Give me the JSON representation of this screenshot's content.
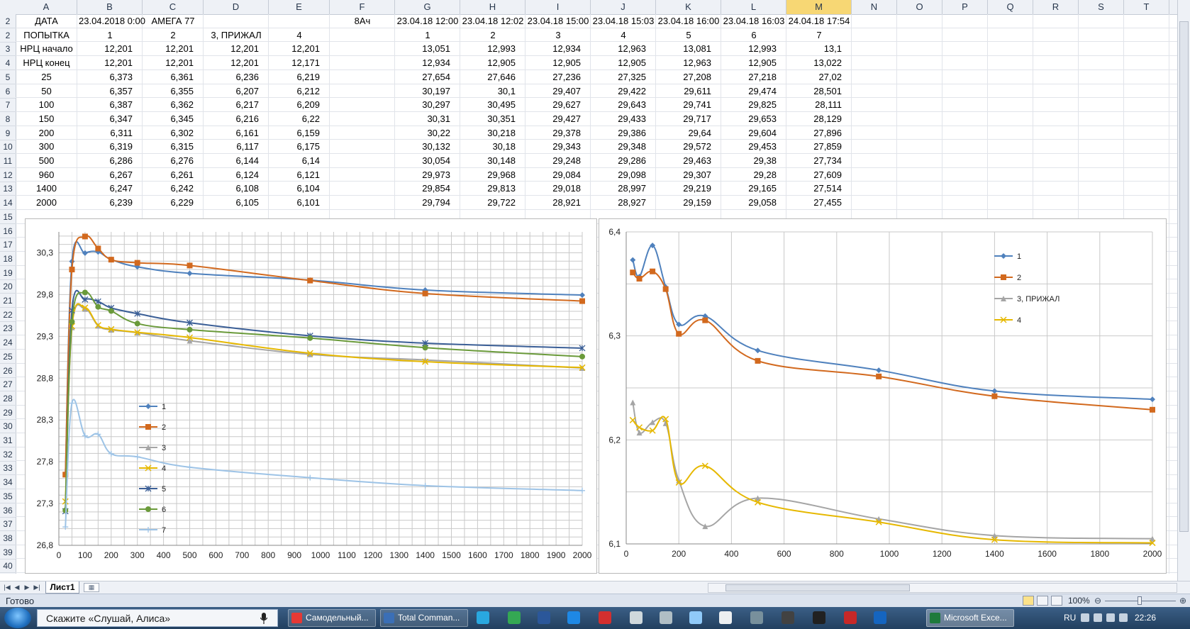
{
  "columns": [
    "A",
    "B",
    "C",
    "D",
    "E",
    "F",
    "G",
    "H",
    "I",
    "J",
    "K",
    "L",
    "M",
    "N",
    "O",
    "P",
    "Q",
    "R",
    "S",
    "T"
  ],
  "selected_column": "M",
  "rows_hdr": [
    "2",
    "2",
    "3",
    "4",
    "5",
    "6",
    "7",
    "8",
    "9",
    "10",
    "11",
    "12",
    "13",
    "14",
    "15",
    "16",
    "17",
    "18",
    "19",
    "20",
    "21",
    "22",
    "23",
    "24",
    "25",
    "26",
    "27",
    "28",
    "29",
    "30",
    "31",
    "32",
    "33",
    "34",
    "35",
    "36",
    "37",
    "38",
    "39",
    "40"
  ],
  "table": [
    [
      "ДАТА",
      "23.04.2018 0:00",
      "АМЕГА 77",
      "",
      "",
      "8Ач",
      "23.04.18 12:00",
      "23.04.18 12:02",
      "23.04.18 15:00",
      "23.04.18 15:03",
      "23.04.18 16:00",
      "23.04.18 16:03",
      "24.04.18 17:54"
    ],
    [
      "ПОПЫТКА",
      "1",
      "2",
      "3, ПРИЖАЛ",
      "4",
      "",
      "1",
      "2",
      "3",
      "4",
      "5",
      "6",
      "7"
    ],
    [
      "НРЦ начало",
      "12,201",
      "12,201",
      "12,201",
      "12,201",
      "",
      "13,051",
      "12,993",
      "12,934",
      "12,963",
      "13,081",
      "12,993",
      "13,1"
    ],
    [
      "НРЦ конец",
      "12,201",
      "12,201",
      "12,201",
      "12,171",
      "",
      "12,934",
      "12,905",
      "12,905",
      "12,905",
      "12,963",
      "12,905",
      "13,022"
    ],
    [
      "25",
      "6,373",
      "6,361",
      "6,236",
      "6,219",
      "",
      "27,654",
      "27,646",
      "27,236",
      "27,325",
      "27,208",
      "27,218",
      "27,02"
    ],
    [
      "50",
      "6,357",
      "6,355",
      "6,207",
      "6,212",
      "",
      "30,197",
      "30,1",
      "29,407",
      "29,422",
      "29,611",
      "29,474",
      "28,501"
    ],
    [
      "100",
      "6,387",
      "6,362",
      "6,217",
      "6,209",
      "",
      "30,297",
      "30,495",
      "29,627",
      "29,643",
      "29,741",
      "29,825",
      "28,111"
    ],
    [
      "150",
      "6,347",
      "6,345",
      "6,216",
      "6,22",
      "",
      "30,31",
      "30,351",
      "29,427",
      "29,433",
      "29,717",
      "29,653",
      "28,129"
    ],
    [
      "200",
      "6,311",
      "6,302",
      "6,161",
      "6,159",
      "",
      "30,22",
      "30,218",
      "29,378",
      "29,386",
      "29,64",
      "29,604",
      "27,896"
    ],
    [
      "300",
      "6,319",
      "6,315",
      "6,117",
      "6,175",
      "",
      "30,132",
      "30,18",
      "29,343",
      "29,348",
      "29,572",
      "29,453",
      "27,859"
    ],
    [
      "500",
      "6,286",
      "6,276",
      "6,144",
      "6,14",
      "",
      "30,054",
      "30,148",
      "29,248",
      "29,286",
      "29,463",
      "29,38",
      "27,734"
    ],
    [
      "960",
      "6,267",
      "6,261",
      "6,124",
      "6,121",
      "",
      "29,973",
      "29,968",
      "29,084",
      "29,098",
      "29,307",
      "29,28",
      "27,609"
    ],
    [
      "1400",
      "6,247",
      "6,242",
      "6,108",
      "6,104",
      "",
      "29,854",
      "29,813",
      "29,018",
      "28,997",
      "29,219",
      "29,165",
      "27,514"
    ],
    [
      "2000",
      "6,239",
      "6,229",
      "6,105",
      "6,101",
      "",
      "29,794",
      "29,722",
      "28,921",
      "28,927",
      "29,159",
      "29,058",
      "27,455"
    ]
  ],
  "chart_data": [
    {
      "type": "line",
      "x": [
        25,
        50,
        100,
        150,
        200,
        300,
        500,
        960,
        1400,
        2000
      ],
      "xlim": [
        0,
        2000
      ],
      "ylim": [
        26.8,
        30.55
      ],
      "xticks": [
        0,
        100,
        200,
        300,
        400,
        500,
        600,
        700,
        800,
        900,
        1000,
        1100,
        1200,
        1300,
        1400,
        1500,
        1600,
        1700,
        1800,
        1900,
        2000
      ],
      "yticks": [
        "26,8",
        "27,3",
        "27,8",
        "28,3",
        "28,8",
        "29,3",
        "29,8",
        "30,3"
      ],
      "grid": true,
      "legend_position": "left-middle",
      "series": [
        {
          "name": "1",
          "color": "#4f81bd",
          "marker": "diamond",
          "values": [
            27.654,
            30.197,
            30.297,
            30.31,
            30.22,
            30.132,
            30.054,
            29.973,
            29.854,
            29.794
          ]
        },
        {
          "name": "2",
          "color": "#d2691e",
          "marker": "square",
          "values": [
            27.646,
            30.1,
            30.495,
            30.351,
            30.218,
            30.18,
            30.148,
            29.968,
            29.813,
            29.722
          ]
        },
        {
          "name": "3",
          "color": "#a5a5a5",
          "marker": "triangle",
          "values": [
            27.236,
            29.407,
            29.627,
            29.427,
            29.378,
            29.343,
            29.248,
            29.084,
            29.018,
            28.921
          ]
        },
        {
          "name": "4",
          "color": "#e6b800",
          "marker": "x",
          "values": [
            27.325,
            29.422,
            29.643,
            29.433,
            29.386,
            29.348,
            29.286,
            29.098,
            28.997,
            28.927
          ]
        },
        {
          "name": "5",
          "color": "#3a5e96",
          "marker": "star",
          "values": [
            27.208,
            29.611,
            29.741,
            29.717,
            29.64,
            29.572,
            29.463,
            29.307,
            29.219,
            29.159
          ]
        },
        {
          "name": "6",
          "color": "#6a9a3a",
          "marker": "circle",
          "values": [
            27.218,
            29.474,
            29.825,
            29.653,
            29.604,
            29.453,
            29.38,
            29.28,
            29.165,
            29.058
          ]
        },
        {
          "name": "7",
          "color": "#9dc3e6",
          "marker": "plus",
          "values": [
            27.02,
            28.501,
            28.111,
            28.129,
            27.896,
            27.859,
            27.734,
            27.609,
            27.514,
            27.455
          ]
        }
      ]
    },
    {
      "type": "line",
      "x": [
        25,
        50,
        100,
        150,
        200,
        300,
        500,
        960,
        1400,
        2000
      ],
      "xlim": [
        0,
        2000
      ],
      "ylim": [
        6.1,
        6.4
      ],
      "xticks": [
        0,
        200,
        400,
        600,
        800,
        1000,
        1200,
        1400,
        1600,
        1800,
        2000
      ],
      "yticks": [
        "6,1",
        "6,2",
        "6,3",
        "6,4"
      ],
      "grid": true,
      "legend_position": "top-right",
      "series": [
        {
          "name": "1",
          "color": "#4f81bd",
          "marker": "diamond",
          "values": [
            6.373,
            6.357,
            6.387,
            6.347,
            6.311,
            6.319,
            6.286,
            6.267,
            6.247,
            6.239
          ]
        },
        {
          "name": "2",
          "color": "#d2691e",
          "marker": "square",
          "values": [
            6.361,
            6.355,
            6.362,
            6.345,
            6.302,
            6.315,
            6.276,
            6.261,
            6.242,
            6.229
          ]
        },
        {
          "name": "3, ПРИЖАЛ",
          "color": "#a5a5a5",
          "marker": "triangle",
          "values": [
            6.236,
            6.207,
            6.217,
            6.216,
            6.161,
            6.117,
            6.144,
            6.124,
            6.108,
            6.105
          ]
        },
        {
          "name": "4",
          "color": "#e6b800",
          "marker": "x",
          "values": [
            6.219,
            6.212,
            6.209,
            6.22,
            6.159,
            6.175,
            6.14,
            6.121,
            6.104,
            6.101
          ]
        }
      ]
    }
  ],
  "sheet_tab": "Лист1",
  "status": "Готово",
  "zoom": "100%",
  "taskbar": {
    "search_text": "Скажите «Слушай, Алиса»",
    "windows": [
      "Самодельный...",
      "Total Comman...",
      "Microsoft Exce..."
    ],
    "lang": "RU",
    "clock": "22:26",
    "colors": {
      "yandex": "#e53935",
      "totalcmd": "#3b6fb6",
      "excel": "#1e7a3c"
    }
  }
}
